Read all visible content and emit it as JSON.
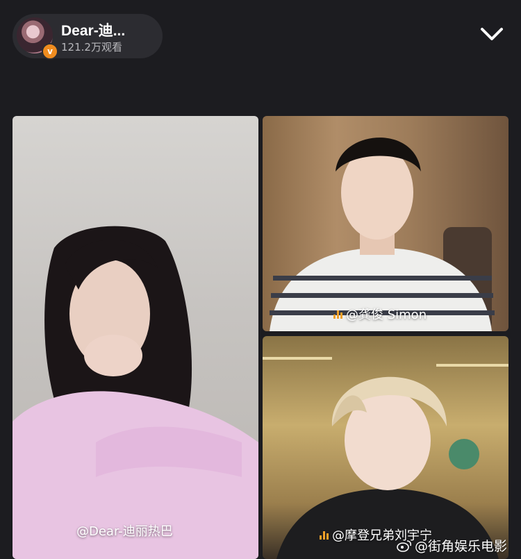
{
  "header": {
    "host_name": "Dear-迪...",
    "host_views": "121.2万观看",
    "host_badge": "v",
    "collapse_icon": "chevron-down-icon"
  },
  "tiles": [
    {
      "label": "@Dear-迪丽热巴",
      "mic_icon": "audio-bars-icon"
    },
    {
      "label": "@龚俊 Simon",
      "mic_icon": "audio-bars-icon"
    },
    {
      "label": "@摩登兄弟刘宇宁",
      "mic_icon": "audio-bars-icon"
    }
  ],
  "watermark": {
    "text": "@街角娱乐电影",
    "icon": "weibo-icon"
  },
  "colors": {
    "background": "#1c1c20",
    "pill": "#2c2c31",
    "badge": "#f08c1f",
    "mic": "#f0a028"
  }
}
